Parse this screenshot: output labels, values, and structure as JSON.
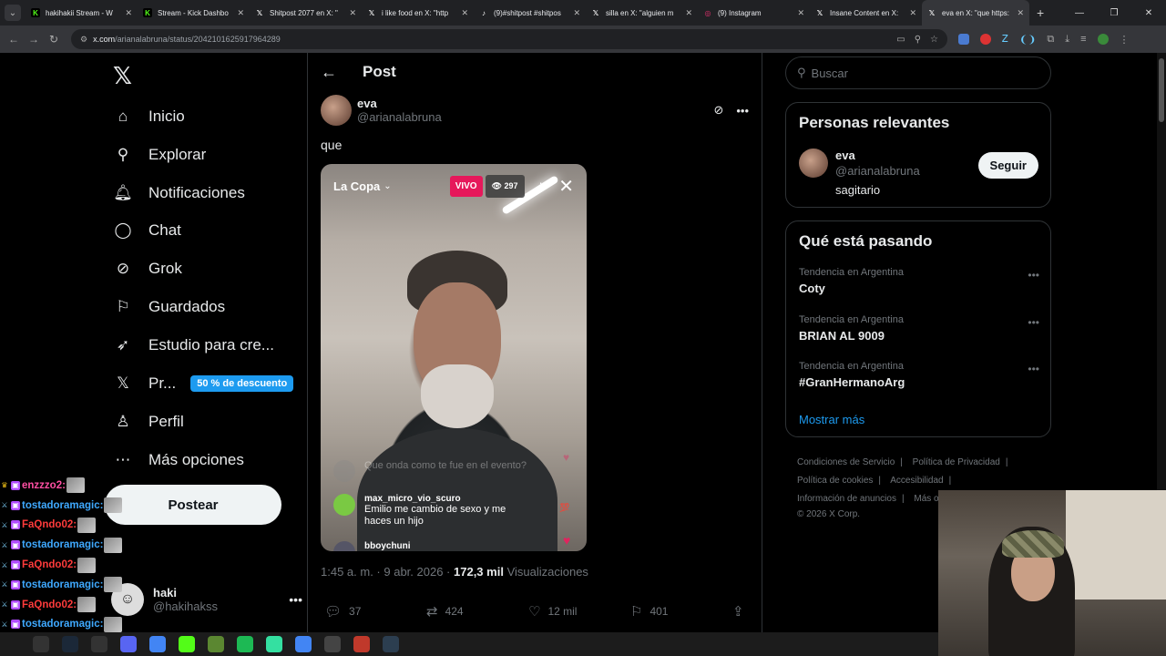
{
  "browser": {
    "tabs": [
      {
        "title": "hakihakii Stream - W",
        "favicon": "kick-icon",
        "color": "#53fc18",
        "active": false
      },
      {
        "title": "Stream - Kick Dashbo",
        "favicon": "kick-icon",
        "color": "#53fc18",
        "active": false
      },
      {
        "title": "Shitpost 2077 en X: \"",
        "favicon": "x-icon",
        "color": "#ffffff",
        "active": false
      },
      {
        "title": "i like food en X: \"http",
        "favicon": "x-icon",
        "color": "#ffffff",
        "active": false
      },
      {
        "title": "(9)#shitpost #shitpos",
        "favicon": "tiktok-icon",
        "color": "#ffffff",
        "active": false
      },
      {
        "title": "silla en X: \"alguien m",
        "favicon": "x-icon",
        "color": "#ffffff",
        "active": false
      },
      {
        "title": "(9) Instagram",
        "favicon": "instagram-icon",
        "color": "#e1306c",
        "active": false
      },
      {
        "title": "Insane Content en X:",
        "favicon": "x-icon",
        "color": "#ffffff",
        "active": false
      },
      {
        "title": "eva en X: \"que https:",
        "favicon": "x-icon",
        "color": "#ffffff",
        "active": true
      }
    ],
    "url_domain": "x.com",
    "url_path": "/arianalabruna/status/2042101625917964289"
  },
  "leftnav": {
    "items": [
      {
        "label": "Inicio",
        "icon": "home-icon",
        "glyph": "⌂"
      },
      {
        "label": "Explorar",
        "icon": "search-icon",
        "glyph": "⚲"
      },
      {
        "label": "Notificaciones",
        "icon": "bell-icon",
        "glyph": "🔔︎"
      },
      {
        "label": "Chat",
        "icon": "chat-icon",
        "glyph": "◯"
      },
      {
        "label": "Grok",
        "icon": "grok-icon",
        "glyph": "⊘"
      },
      {
        "label": "Guardados",
        "icon": "bookmark-icon",
        "glyph": "⚐"
      },
      {
        "label": "Estudio para cre...",
        "icon": "rocket-icon",
        "glyph": "➶"
      },
      {
        "label": "Pr...",
        "icon": "x-premium-icon",
        "glyph": "𝕏"
      },
      {
        "label": "Perfil",
        "icon": "person-icon",
        "glyph": "♙"
      },
      {
        "label": "Más opciones",
        "icon": "more-options-icon",
        "glyph": "⋯"
      }
    ],
    "premium_badge": "50 % de descuento",
    "post_button": "Postear",
    "account": {
      "name": "haki",
      "handle": "@hakihakss"
    }
  },
  "post": {
    "header_title": "Post",
    "author_name": "eva",
    "author_handle": "@arianalabruna",
    "text": "que",
    "media": {
      "channel": "La Copa",
      "live_label": "VIVO",
      "viewers": "297",
      "comments": [
        {
          "user": "",
          "text": "Que onda como te fue en el evento?"
        },
        {
          "user": "max_micro_vio_scuro",
          "text": "Emilio me cambio de sexo y me haces un hijo"
        },
        {
          "user": "bboychuni",
          "text": ""
        }
      ]
    },
    "time": "1:45 a. m.",
    "date": "9 abr. 2026",
    "views_count": "172,3 mil",
    "views_label": "Visualizaciones",
    "stats": {
      "replies": "37",
      "reposts": "424",
      "likes": "12 mil",
      "bookmarks": "401"
    }
  },
  "right": {
    "search_placeholder": "Buscar",
    "relevant_title": "Personas relevantes",
    "relevant_user": {
      "name": "eva",
      "handle": "@arianalabruna",
      "bio": "sagitario"
    },
    "follow_label": "Seguir",
    "trends_title": "Qué está pasando",
    "trends": [
      {
        "context": "Tendencia en Argentina",
        "name": "Coty"
      },
      {
        "context": "Tendencia en Argentina",
        "name": "BRIAN AL 9009"
      },
      {
        "context": "Tendencia en Argentina",
        "name": "#GranHermanoArg"
      }
    ],
    "show_more": "Mostrar más",
    "footer_links": [
      "Condiciones de Servicio",
      "Política de Privacidad",
      "Política de cookies",
      "Accesibilidad",
      "Información de anuncios",
      "Más op"
    ],
    "copyright": "© 2026 X Corp."
  },
  "stream_chat": [
    {
      "user": "enzzzo2:",
      "color": "#ff4fa3",
      "badge": "crown-icon"
    },
    {
      "user": "tostadoramagic:",
      "color": "#3fa9ff",
      "badge": "sword-icon"
    },
    {
      "user": "FaQndo02:",
      "color": "#ff3b3b",
      "badge": "sword-icon"
    },
    {
      "user": "tostadoramagic:",
      "color": "#3fa9ff",
      "badge": "sword-icon"
    },
    {
      "user": "FaQndo02:",
      "color": "#ff3b3b",
      "badge": "sword-icon"
    },
    {
      "user": "tostadoramagic:",
      "color": "#3fa9ff",
      "badge": "sword-icon"
    },
    {
      "user": "FaQndo02:",
      "color": "#ff3b3b",
      "badge": "sword-icon"
    },
    {
      "user": "tostadoramagic:",
      "color": "#3fa9ff",
      "badge": "sword-icon"
    },
    {
      "user": "tostadoramagic",
      "color": "#3fa9ff",
      "badge": "sword-icon"
    }
  ],
  "taskbar_apps": [
    "search-icon",
    "steam-icon",
    "obs-icon",
    "discord-icon",
    "chrome-icon",
    "kick-icon",
    "minecraft-icon",
    "spotify-icon",
    "tripadvisor-icon",
    "chrome-icon",
    "settings-icon",
    "game-icon",
    "cursor-icon"
  ]
}
